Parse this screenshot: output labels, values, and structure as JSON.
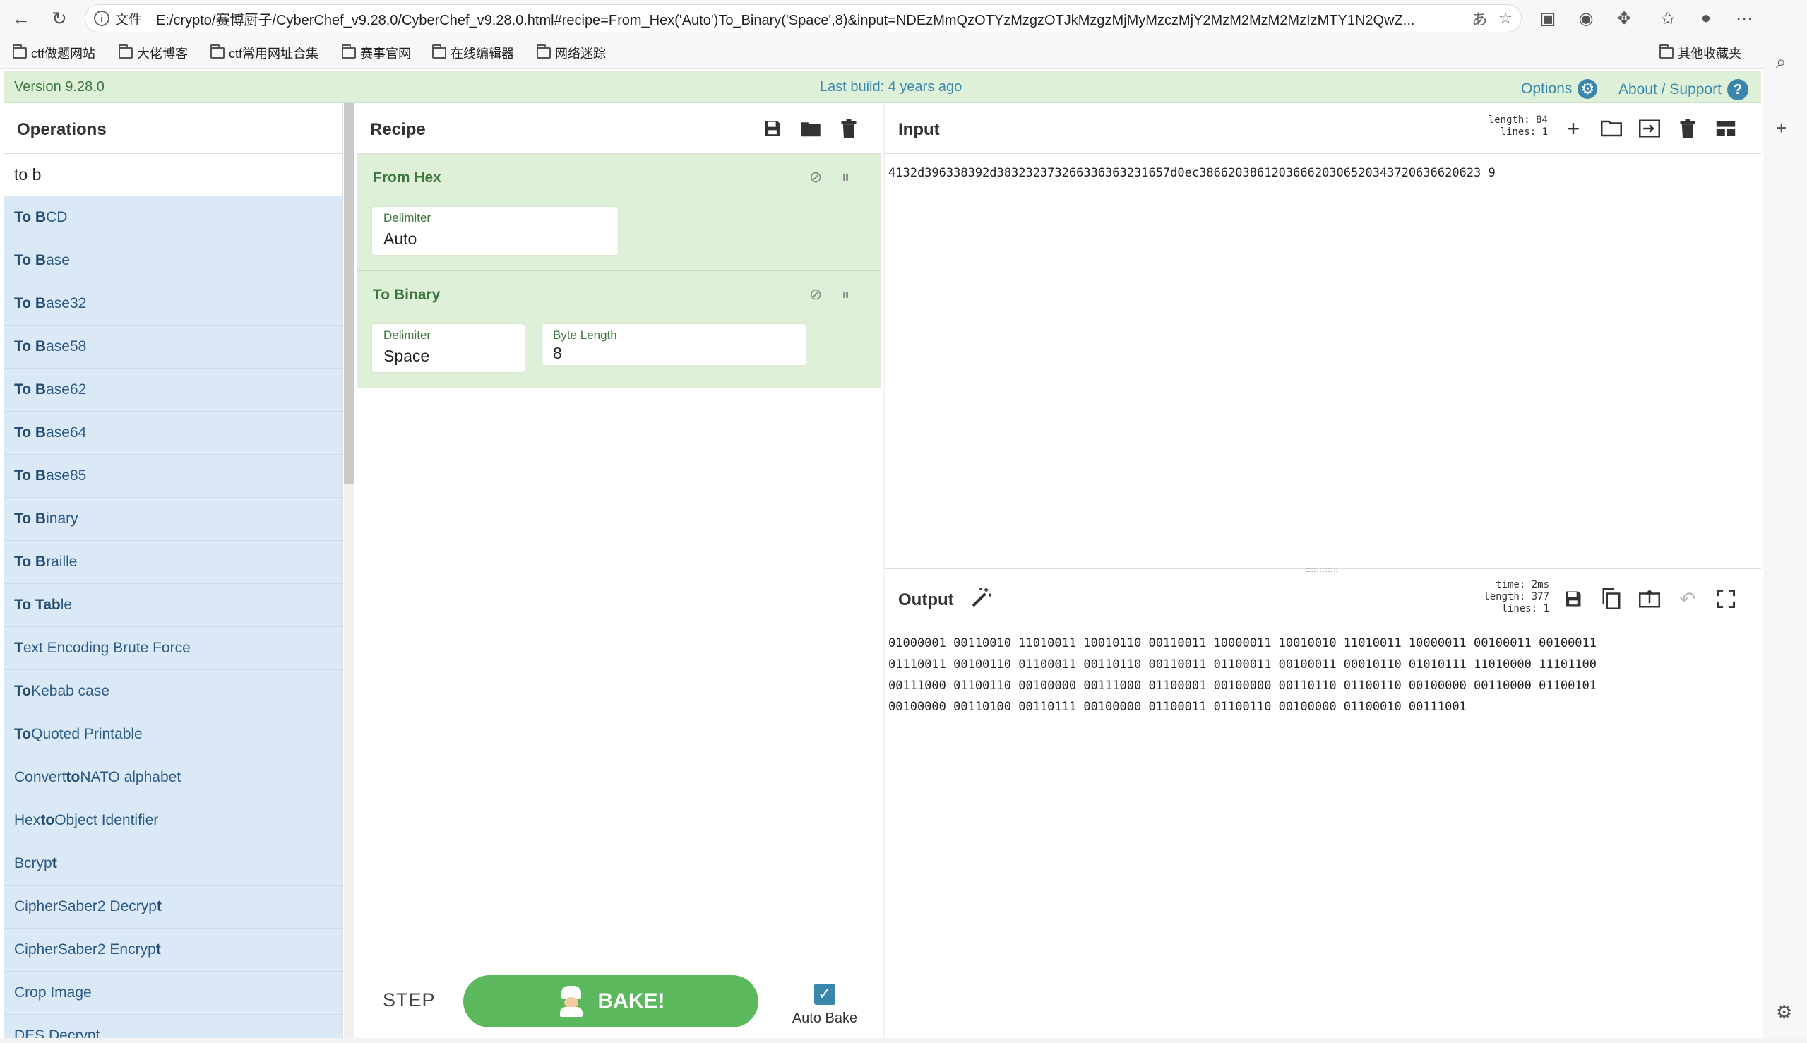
{
  "browser": {
    "file_label": "文件",
    "url": "E:/crypto/赛博厨子/CyberChef_v9.28.0/CyberChef_v9.28.0.html#recipe=From_Hex('Auto')To_Binary('Space',8)&input=NDEzMmQzOTYzMzgzOTJkMzgzMjMyMzczMjY2MzM2MzM2MzIzMTY1N2QwZ...",
    "bookmarks": [
      "ctf做题网站",
      "大佬博客",
      "ctf常用网址合集",
      "赛事官网",
      "在线编辑器",
      "网络迷踪"
    ],
    "other_bookmarks": "其他收藏夹"
  },
  "banner": {
    "version": "Version 9.28.0",
    "last_build": "Last build: 4 years ago",
    "options": "Options",
    "about": "About / Support"
  },
  "operations": {
    "title": "Operations",
    "search_value": "to b",
    "items": [
      {
        "pre": "",
        "hl": "To B",
        "post": "CD"
      },
      {
        "pre": "",
        "hl": "To B",
        "post": "ase"
      },
      {
        "pre": "",
        "hl": "To B",
        "post": "ase32"
      },
      {
        "pre": "",
        "hl": "To B",
        "post": "ase58"
      },
      {
        "pre": "",
        "hl": "To B",
        "post": "ase62"
      },
      {
        "pre": "",
        "hl": "To B",
        "post": "ase64"
      },
      {
        "pre": "",
        "hl": "To B",
        "post": "ase85"
      },
      {
        "pre": "",
        "hl": "To B",
        "post": "inary"
      },
      {
        "pre": "",
        "hl": "To B",
        "post": "raille"
      },
      {
        "pre": "",
        "hl": "To Tab",
        "post": "le"
      },
      {
        "pre": "",
        "hl": "T",
        "post": "ext Encoding Brute Force"
      },
      {
        "pre": "",
        "hl": "To",
        "post": " Kebab case"
      },
      {
        "pre": "",
        "hl": "To",
        "post": " Quoted Printable"
      },
      {
        "pre": "Convert ",
        "hl": "to",
        "post": " NATO alphabet"
      },
      {
        "pre": "Hex ",
        "hl": "to",
        "post": " Object Identifier"
      },
      {
        "pre": "Bcryp",
        "hl": "t",
        "post": ""
      },
      {
        "pre": "CipherSaber2 Decryp",
        "hl": "t",
        "post": ""
      },
      {
        "pre": "CipherSaber2 Encryp",
        "hl": "t",
        "post": ""
      },
      {
        "pre": "Crop Image",
        "hl": "",
        "post": ""
      },
      {
        "pre": "DES Decrypt",
        "hl": "",
        "post": ""
      }
    ]
  },
  "recipe": {
    "title": "Recipe",
    "ops": [
      {
        "name": "From Hex",
        "args": [
          {
            "label": "Delimiter",
            "value": "Auto"
          }
        ]
      },
      {
        "name": "To Binary",
        "args": [
          {
            "label": "Delimiter",
            "value": "Space"
          },
          {
            "label": "Byte Length",
            "value": "8"
          }
        ]
      }
    ],
    "step_label": "STEP",
    "bake_label": "BAKE!",
    "auto_bake_label": "Auto Bake"
  },
  "input": {
    "title": "Input",
    "stats": {
      "length": "length: 84",
      "lines": "lines: 1"
    },
    "text": "4132d396338392d383232373266336363231657d0ec386620386120366620306520343720636620623 9"
  },
  "output": {
    "title": "Output",
    "stats": {
      "time": "time: 2ms",
      "length": "length: 377",
      "lines": "lines: 1"
    },
    "text": "01000001 00110010 11010011 10010110 00110011 10000011 10010010 11010011 10000011 00100011 00100011\n01110011 00100110 01100011 00110110 00110011 01100011 00100011 00010110 01010111 11010000 11101100\n00111000 01100110 00100000 00111000 01100001 00100000 00110110 01100110 00100000 00110000 01100101\n00100000 00110100 00110111 00100000 01100011 01100110 00100000 01100010 00111001"
  }
}
